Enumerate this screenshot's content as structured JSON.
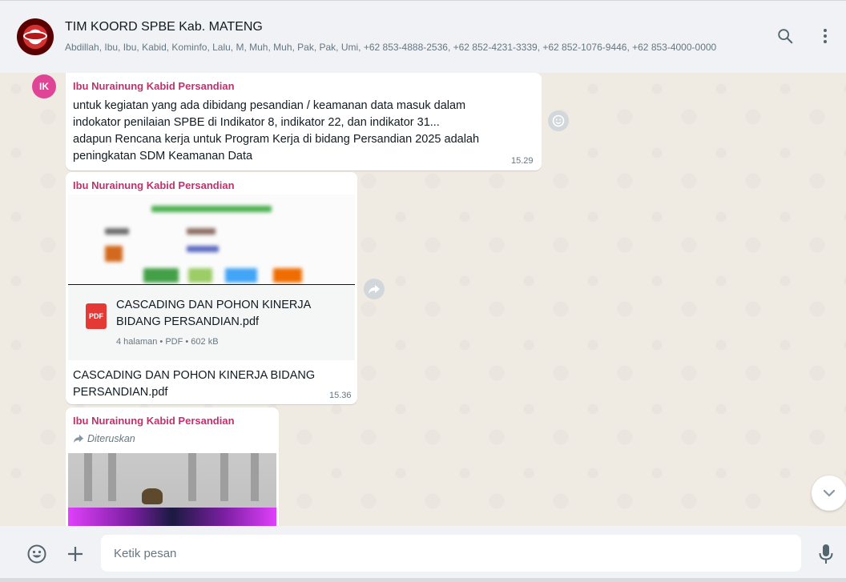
{
  "header": {
    "group_name": "TIM KOORD SPBE Kab. MATENG",
    "members": "Abdillah, Ibu, Ibu, Kabid, Kominfo, Lalu, M, Muh, Muh, Pak, Pak, Umi, +62 853-4888-2536, +62 852-4231-3339, +62 852-1076-9446, +62 853-4000-0000",
    "icons": [
      "search-icon",
      "menu-icon"
    ]
  },
  "messages": [
    {
      "avatar_initials": "IK",
      "sender": "Ibu Nurainung Kabid Persandian",
      "text_lines": [
        "untuk kegiatan yang ada dibidang pesandian / keamanan data masuk dalam",
        "indokator penilaian SPBE di Indikator 8, indikator 22, dan indikator 31...",
        "adapun Rencana kerja untuk Program Kerja di bidang Persandian 2025 adalah",
        "peningkatan SDM Keamanan Data"
      ],
      "time": "15.29"
    },
    {
      "sender": "Ibu Nurainung Kabid Persandian",
      "document": {
        "icon_label": "PDF",
        "name_lines": [
          "CASCADING DAN POHON KINERJA",
          "BIDANG PERSANDIAN.pdf"
        ],
        "meta": "4 halaman • PDF • 602 kB"
      },
      "caption_lines": [
        "CASCADING DAN POHON KINERJA BIDANG",
        "PERSANDIAN.pdf"
      ],
      "time": "15.36"
    },
    {
      "sender": "Ibu Nurainung Kabid Persandian",
      "forwarded_label": "Diteruskan"
    }
  ],
  "composer": {
    "placeholder": "Ketik pesan"
  },
  "colors": {
    "chat_bg": "#efeae2",
    "header_bg": "#f0f2f5",
    "sender_name": "#c2306e",
    "avatar_bg": "#e04497",
    "pdf_red": "#e53935"
  }
}
